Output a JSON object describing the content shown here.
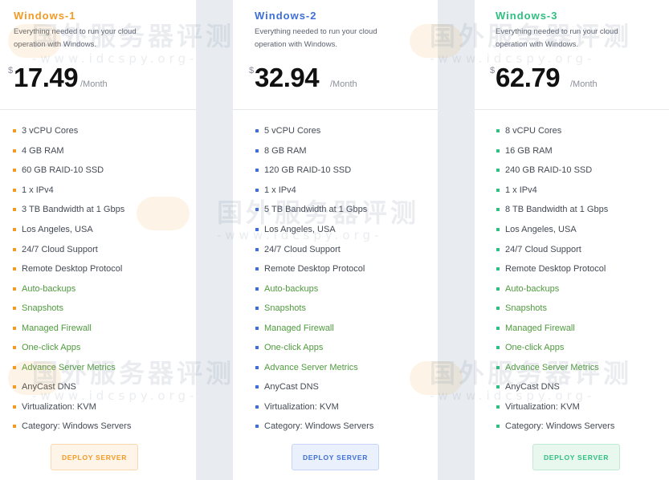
{
  "plans": [
    {
      "name": "Windows-1",
      "description": "Everything needed to run your cloud operation with Windows.",
      "currency": "$",
      "price": "17.49",
      "period": "/Month",
      "accent": "#f39a25",
      "features": [
        "3 vCPU Cores",
        "4 GB RAM",
        "60 GB RAID-10 SSD",
        "1 x IPv4",
        "3 TB Bandwidth at 1 Gbps",
        "Los Angeles, USA",
        "24/7 Cloud Support",
        "Remote Desktop Protocol",
        "Auto-backups",
        "Snapshots",
        "Managed Firewall",
        "One-click Apps",
        "Advance Server Metrics",
        "AnyCast DNS",
        "Virtualization: KVM",
        "Category: Windows Servers"
      ],
      "button": "DEPLOY SERVER"
    },
    {
      "name": "Windows-2",
      "description": "Everything needed to run your cloud operation with Windows.",
      "currency": "$",
      "price": "32.94",
      "period": "/Month",
      "accent": "#3d6fd6",
      "features": [
        "5 vCPU Cores",
        "8 GB RAM",
        "120 GB RAID-10 SSD",
        "1 x IPv4",
        "5 TB Bandwidth at 1 Gbps",
        "Los Angeles, USA",
        "24/7 Cloud Support",
        "Remote Desktop Protocol",
        "Auto-backups",
        "Snapshots",
        "Managed Firewall",
        "One-click Apps",
        "Advance Server Metrics",
        "AnyCast DNS",
        "Virtualization: KVM",
        "Category: Windows Servers"
      ],
      "button": "DEPLOY SERVER"
    },
    {
      "name": "Windows-3",
      "description": "Everything needed to run your cloud operation with Windows.",
      "currency": "$",
      "price": "62.79",
      "period": "/Month",
      "accent": "#2fbf7f",
      "features": [
        "8 vCPU Cores",
        "16 GB RAM",
        "240 GB RAID-10 SSD",
        "1 x IPv4",
        "8 TB Bandwidth at 1 Gbps",
        "Los Angeles, USA",
        "24/7 Cloud Support",
        "Remote Desktop Protocol",
        "Auto-backups",
        "Snapshots",
        "Managed Firewall",
        "One-click Apps",
        "Advance Server Metrics",
        "AnyCast DNS",
        "Virtualization: KVM",
        "Category: Windows Servers"
      ],
      "button": "DEPLOY SERVER"
    }
  ],
  "watermark": {
    "title": "国外服务器评测",
    "url": "-www.idcspy.org-"
  },
  "colors": {
    "extra_feature_text": "#4f9b3e",
    "orange_button_bg": "#fff4e8",
    "blue_button_bg": "#eaf1fd",
    "green_button_bg": "#e8f8ef"
  }
}
